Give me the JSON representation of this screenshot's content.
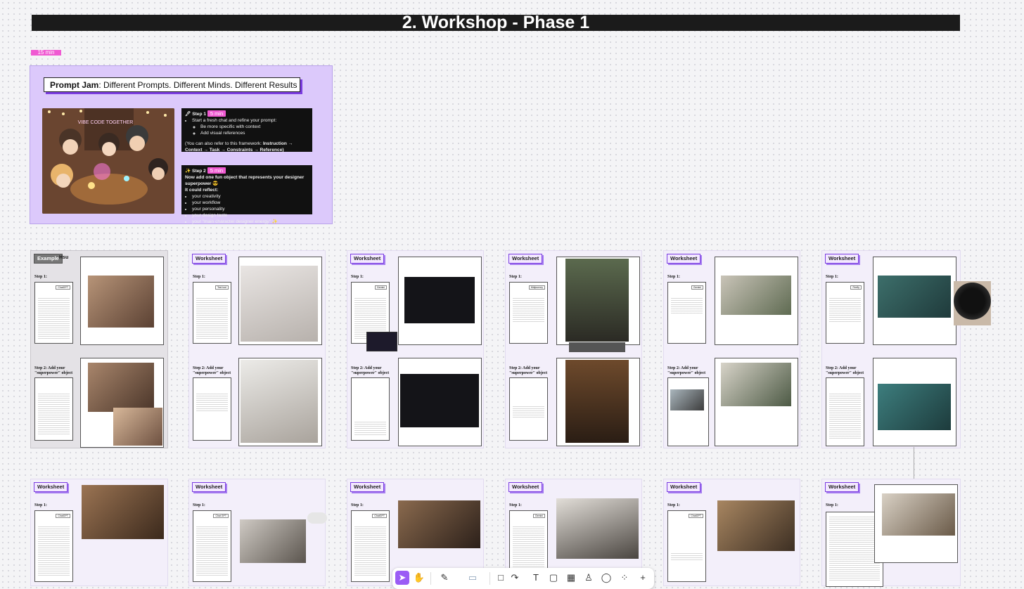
{
  "header": {
    "title": "2. Workshop - Phase 1",
    "timer": "15 min"
  },
  "intro": {
    "prompt_bold": "Prompt Jam",
    "prompt_rest": ": Different Prompts. Different Minds. Different Results",
    "illustration_text": "VIBE CODE TOGETHER",
    "step1": {
      "label": "🖋 Step 1",
      "time": "5 min",
      "intro": "Start a fresh chat and refine your prompt:",
      "bullets": [
        "Be more specific with context",
        "Add visual references"
      ],
      "framework_pre": "(You can also refer to this framework: ",
      "framework_bold": "Instruction → Context → Task → Constraints → Reference)"
    },
    "step2": {
      "label": "✨ Step 2",
      "time": "5 min",
      "intro": "Now add one fun object that represents your designer superpower 😎",
      "reflect": "It could reflect:",
      "bullets": [
        "your creativity",
        "your workflow",
        "your personality",
        "your design taste",
        "your \"main character designer energy\" ✨"
      ]
    }
  },
  "worksheets": {
    "example_tag": "Example",
    "example_name": "Hsu",
    "tag": "Worksheet",
    "step1": "Step 1:",
    "step2": "Step 2: Add your \"superpower\" object",
    "tools": [
      "ChatGPT",
      "Text tool",
      "Gemini",
      "Midjourney",
      "Gemini",
      "Firefly",
      "ChatGPT",
      "Chat GPT",
      "ChatGPT",
      "Gemini",
      "ChatGPT",
      ""
    ]
  },
  "toolbar": {
    "items": [
      "move-tool",
      "hand-tool",
      "pen-tool",
      "marker-tool",
      "frame-tool",
      "connector-tool",
      "text-tool",
      "sticky-note-tool",
      "table-tool",
      "stamp-tool",
      "comment-tool",
      "more-tools",
      "add-tool"
    ],
    "glyphs": [
      "➤",
      "✋",
      "✎",
      "▭",
      "□",
      "↷",
      "T",
      "▢",
      "▦",
      "♙",
      "◯",
      "⁘",
      "+"
    ]
  },
  "colors": {
    "accent": "#9b5cf5",
    "timer": "#f05ad2",
    "panel": "#dcc9fb",
    "titlebar": "#1b1b1b"
  }
}
